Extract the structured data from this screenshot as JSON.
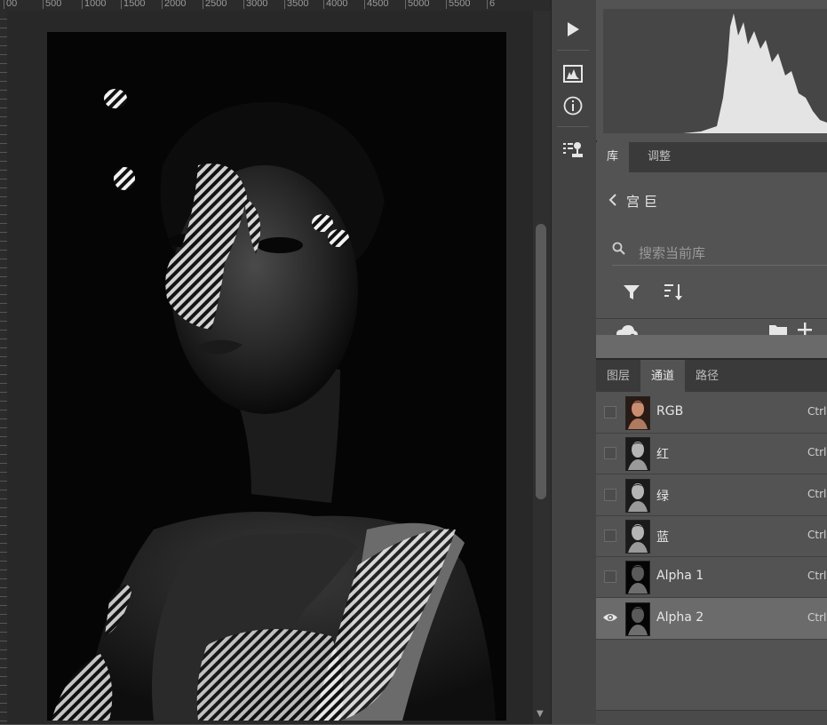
{
  "ruler": {
    "ticks": [
      "00",
      "500",
      "1000",
      "1500",
      "2000",
      "2500",
      "3000",
      "3500",
      "4000",
      "4500",
      "5000",
      "5500",
      "6"
    ]
  },
  "toolbar": {
    "icons": [
      "play-icon",
      "histogram-panel-icon",
      "info-icon",
      "clone-source-icon"
    ]
  },
  "library": {
    "tabs": [
      "库",
      "调整"
    ],
    "active_tab": "库",
    "breadcrumb": "宫 巨",
    "search_placeholder": "搜索当前库"
  },
  "channels_panel": {
    "tabs": [
      "图层",
      "通道",
      "路径"
    ],
    "active_tab": "通道",
    "rows": [
      {
        "name": "RGB",
        "shortcut": "Ctrl+",
        "visible": false,
        "selected": false,
        "thumb": "color"
      },
      {
        "name": "红",
        "shortcut": "Ctrl+",
        "visible": false,
        "selected": false,
        "thumb": "gray"
      },
      {
        "name": "绿",
        "shortcut": "Ctrl+",
        "visible": false,
        "selected": false,
        "thumb": "gray"
      },
      {
        "name": "蓝",
        "shortcut": "Ctrl+",
        "visible": false,
        "selected": false,
        "thumb": "gray"
      },
      {
        "name": "Alpha 1",
        "shortcut": "Ctrl+",
        "visible": false,
        "selected": false,
        "thumb": "dark"
      },
      {
        "name": "Alpha 2",
        "shortcut": "Ctrl+",
        "visible": true,
        "selected": true,
        "thumb": "dark"
      }
    ]
  },
  "colors": {
    "panel_bg": "#535353",
    "tab_bar_bg": "#3a3a3a",
    "selected_row": "#6b6b6b",
    "canvas_bg": "#282828"
  }
}
